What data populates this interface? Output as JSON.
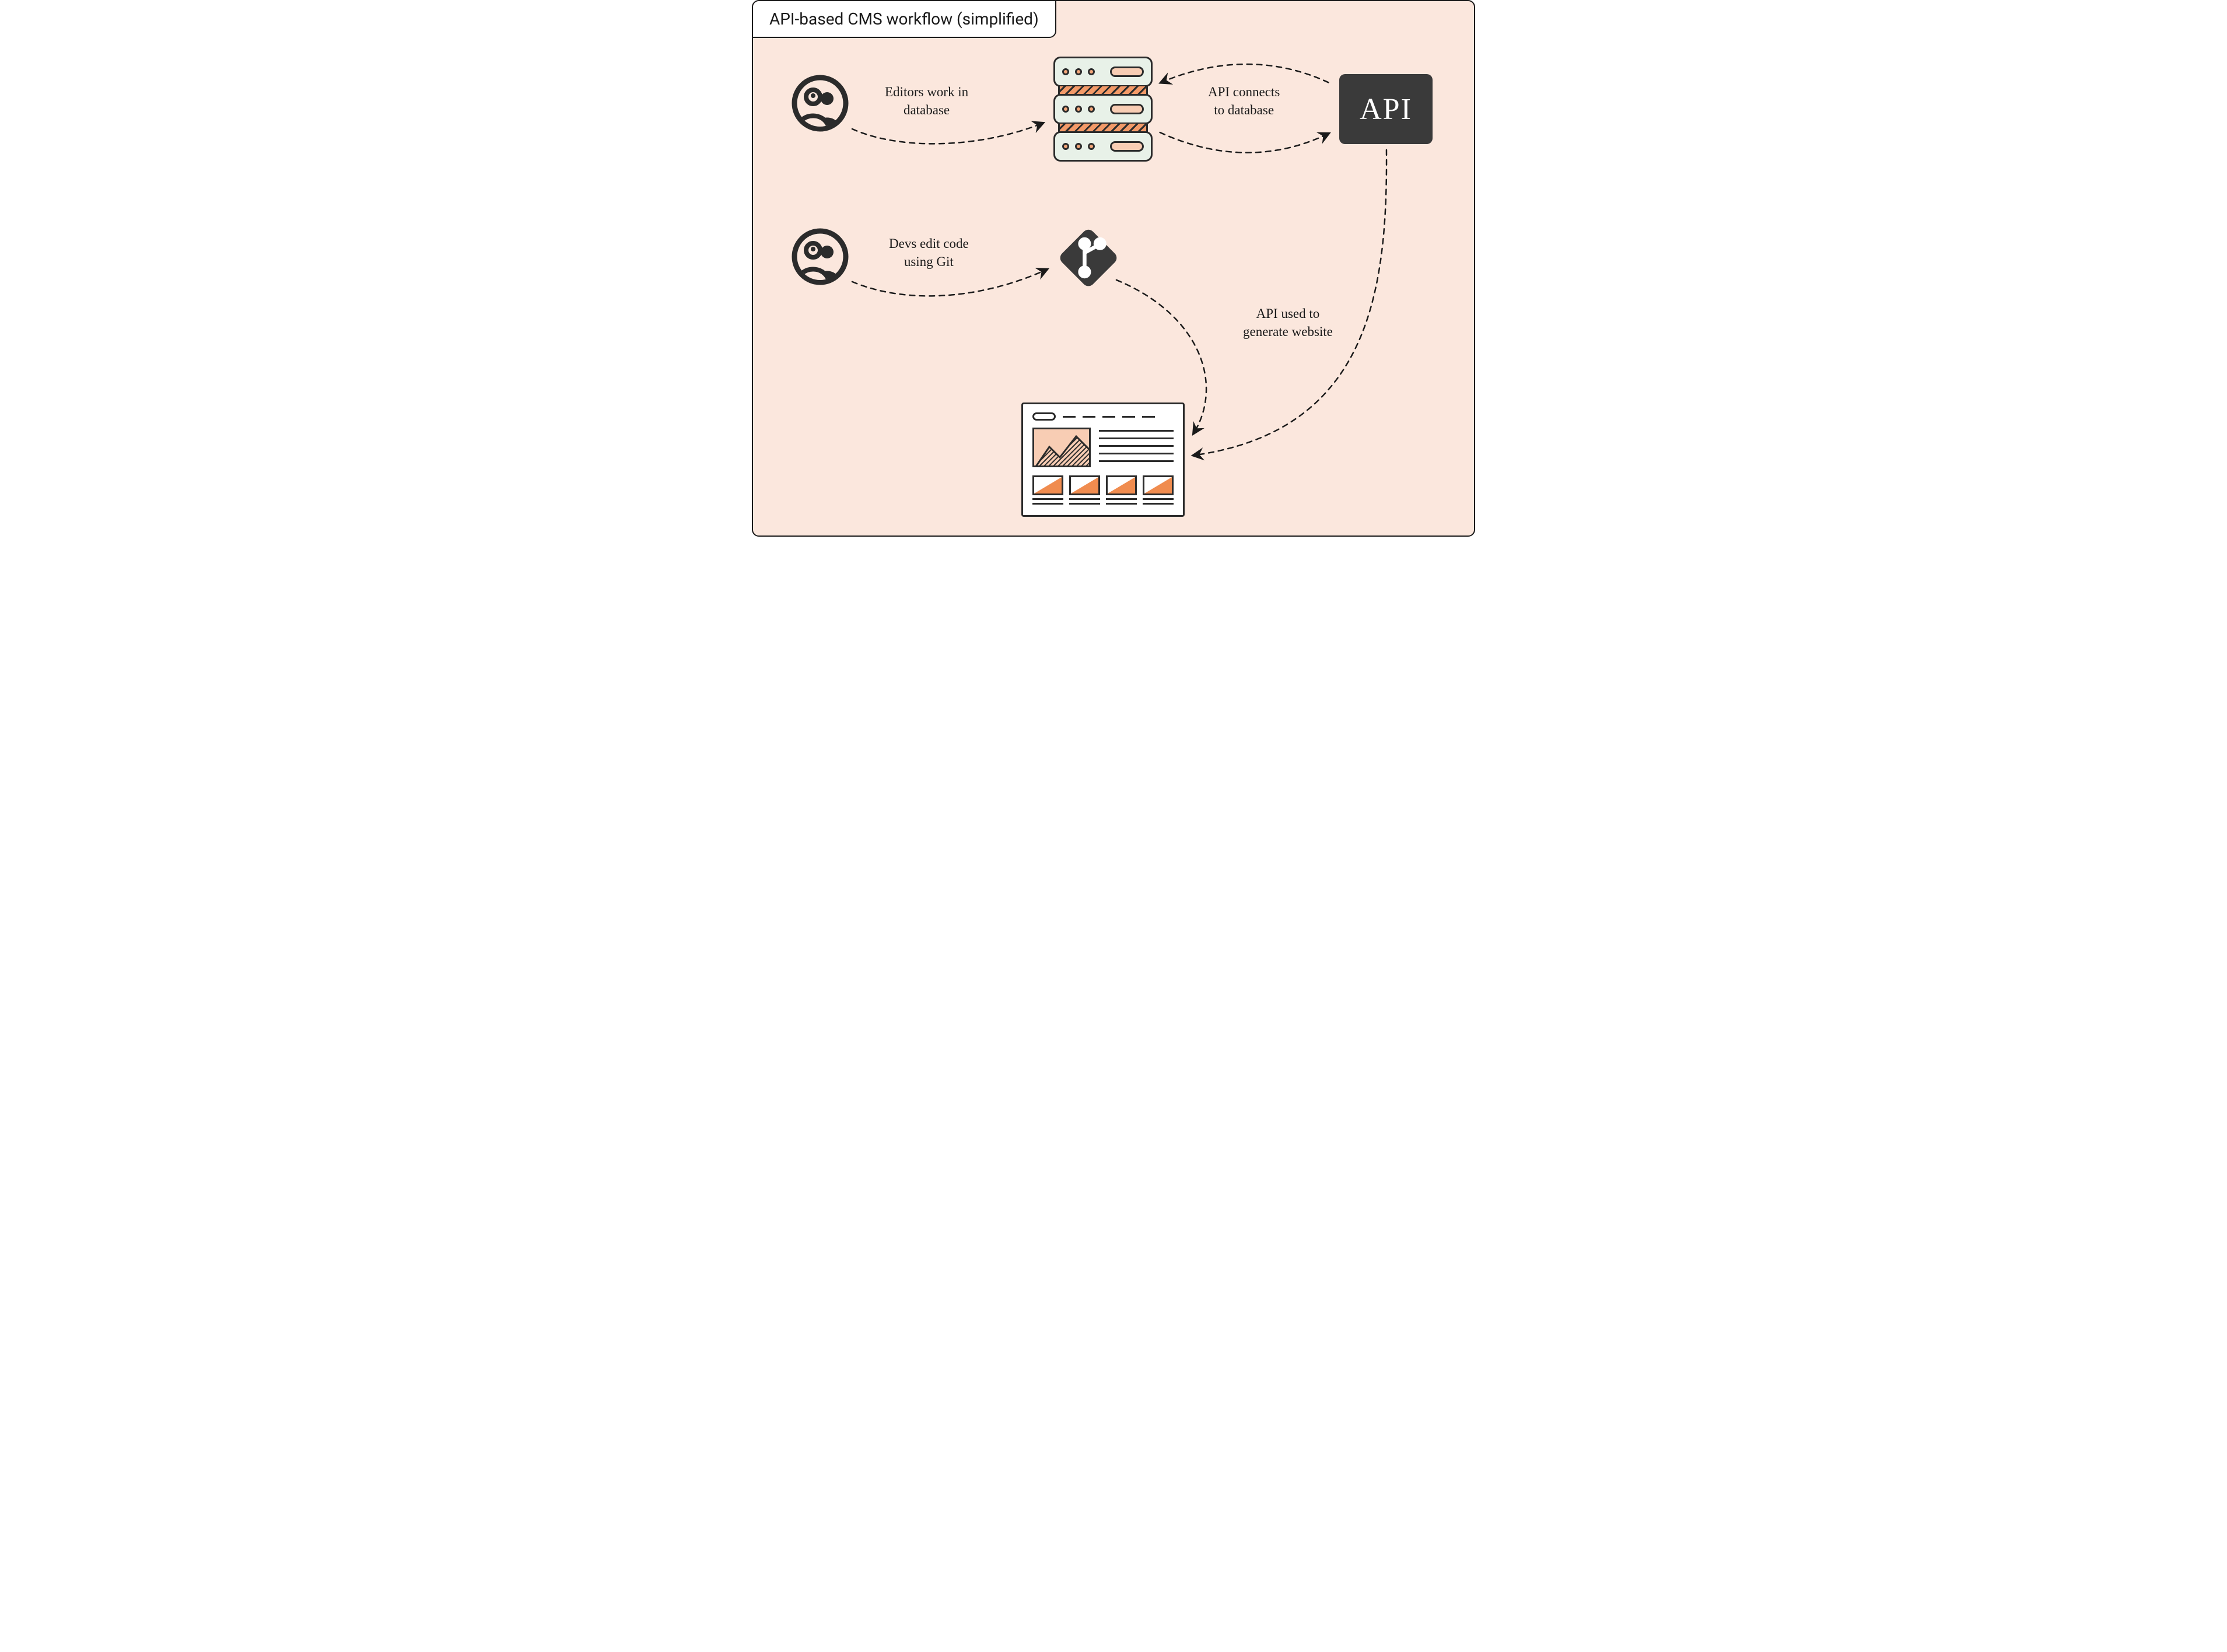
{
  "title": "API-based CMS workflow (simplified)",
  "nodes": {
    "editors": {
      "icon": "people-icon"
    },
    "devs": {
      "icon": "people-icon"
    },
    "database": {
      "icon": "server-stack-icon"
    },
    "api": {
      "label": "API"
    },
    "git": {
      "icon": "git-icon"
    },
    "website": {
      "icon": "website-icon"
    }
  },
  "edges": {
    "editors_to_db": "Editors work in\ndatabase",
    "api_db": "API connects\nto database",
    "devs_to_git": "Devs edit code\nusing Git",
    "api_to_site": "API used to\ngenerate website"
  }
}
